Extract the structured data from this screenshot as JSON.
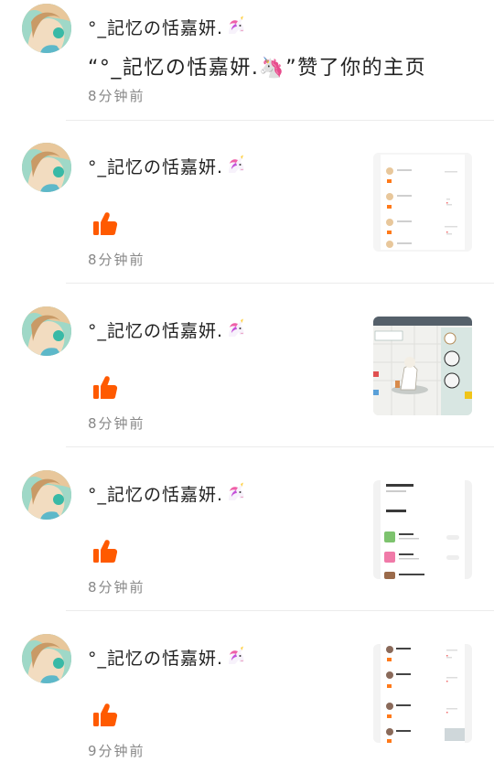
{
  "colors": {
    "accent_like": "#ff5a00",
    "divider": "#ececec",
    "time_text": "#888888"
  },
  "notifications": [
    {
      "username": "°_記忆の恬嘉妍.",
      "emoji": "unicorn-icon",
      "message": "“°_記忆の恬嘉妍.🦄”赞了你的主页",
      "time": "8分钟前",
      "type": "profile-like"
    },
    {
      "username": "°_記忆の恬嘉妍.",
      "emoji": "unicorn-icon",
      "icon": "thumbs-up-icon",
      "time": "8分钟前",
      "type": "post-like",
      "preview": "list-screenshot"
    },
    {
      "username": "°_記忆の恬嘉妍.",
      "emoji": "unicorn-icon",
      "icon": "thumbs-up-icon",
      "time": "8分钟前",
      "type": "post-like",
      "preview": "game-screenshot"
    },
    {
      "username": "°_記忆の恬嘉妍.",
      "emoji": "unicorn-icon",
      "icon": "thumbs-up-icon",
      "time": "8分钟前",
      "type": "post-like",
      "preview": "app-list-screenshot"
    },
    {
      "username": "°_記忆の恬嘉妍.",
      "emoji": "unicorn-icon",
      "icon": "thumbs-up-icon",
      "time": "9分钟前",
      "type": "post-like",
      "preview": "comments-screenshot"
    }
  ]
}
